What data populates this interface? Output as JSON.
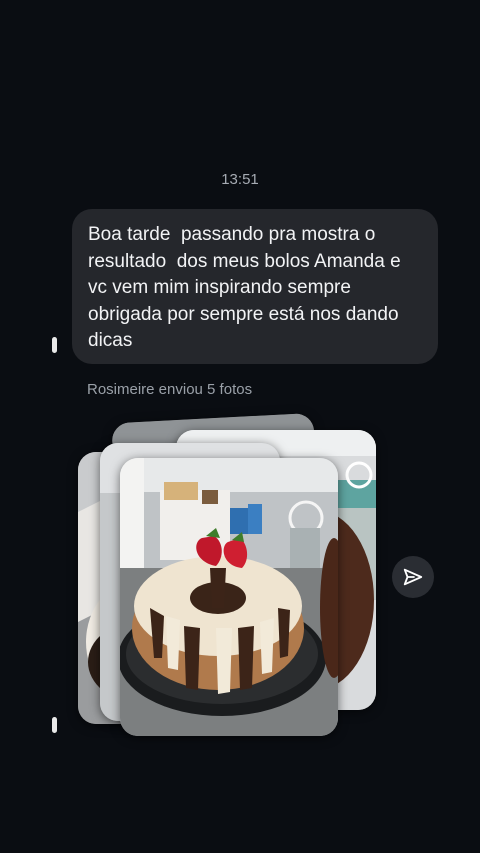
{
  "conversation": {
    "timestamp": "13:51",
    "message_text": "Boa tarde  passando pra mostra o resultado  dos meus bolos Amanda e vc vem mim inspirando sempre obrigada por sempre está nos dando dicas",
    "sender_note": "Rosimeire enviou 5 fotos"
  },
  "photos": {
    "count": 5,
    "content": "bundt cake with white and chocolate icing topped with strawberries"
  },
  "icons": {
    "share": "send-paper-plane-icon"
  },
  "colors": {
    "background": "#0a0d12",
    "bubble": "#25272c",
    "text_secondary": "#9aa0a8"
  }
}
